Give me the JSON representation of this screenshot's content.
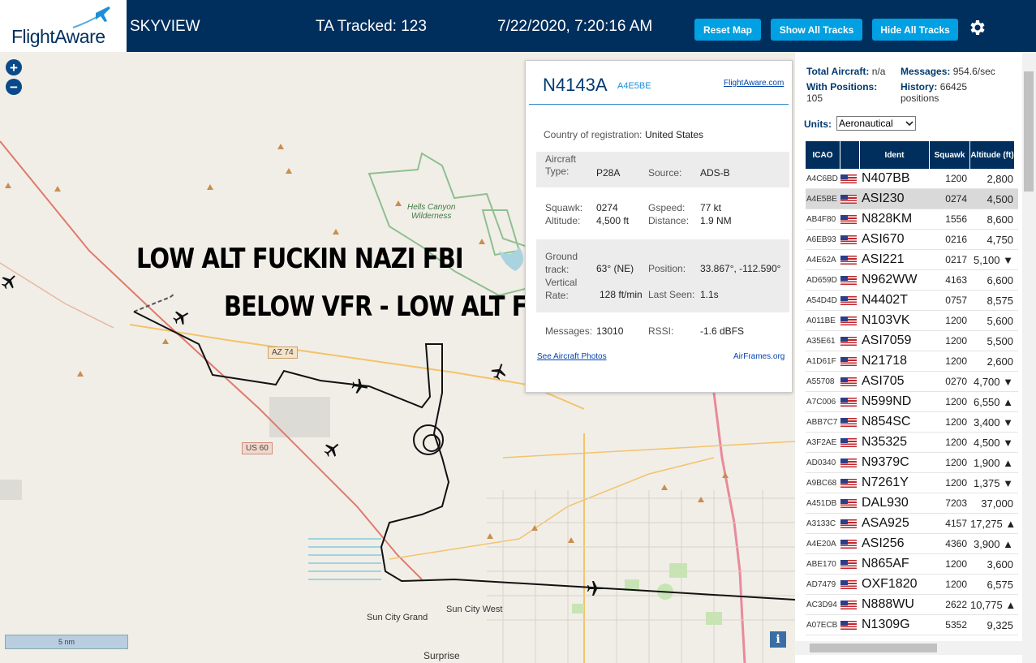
{
  "header": {
    "logo_text": "FlightAware",
    "app_title": "SKYVIEW",
    "tracked": "TA Tracked: 123",
    "datetime": "7/22/2020, 7:20:16 AM",
    "reset_map": "Reset Map",
    "show_all": "Show All Tracks",
    "hide_all": "Hide All Tracks",
    "settings_icon": "gear-icon"
  },
  "map": {
    "zoom_in": "+",
    "zoom_out": "−",
    "overlay_line1": "LOW ALT FUCKIN NAZI FBI",
    "overlay_line2": "BELOW VFR - LOW ALT FUCKIN",
    "scale": "5 nm",
    "info": "i",
    "labels": {
      "wilderness": "Hells Canyon\nWilderness",
      "az74": "AZ 74",
      "us60": "US 60",
      "sun_city_west": "Sun City West",
      "sun_city_grand": "Sun City Grand",
      "surprise": "Surprise"
    }
  },
  "popup": {
    "registration": "N4143A",
    "hex": "A4E5BE",
    "fa_link": "FlightAware.com",
    "country_label": "Country of registration:",
    "country_value": "United States",
    "aircraft_type_label": "Aircraft Type:",
    "aircraft_type_value": "P28A",
    "source_label": "Source:",
    "source_value": "ADS-B",
    "squawk_label": "Squawk:",
    "squawk_value": "0274",
    "gspeed_label": "Gspeed:",
    "gspeed_value": "77 kt",
    "altitude_label": "Altitude:",
    "altitude_value": "4,500 ft",
    "distance_label": "Distance:",
    "distance_value": "1.9 NM",
    "ground_track_label": "Ground track:",
    "ground_track_value": "63° (NE)",
    "position_label": "Position:",
    "position_value": "33.867°, -112.590°",
    "vertical_rate_label": "Vertical Rate:",
    "vertical_rate_value": "128 ft/min",
    "last_seen_label": "Last Seen:",
    "last_seen_value": "1.1s",
    "messages_label": "Messages:",
    "messages_value": "13010",
    "rssi_label": "RSSI:",
    "rssi_value": "-1.6 dBFS",
    "photos_link": "See Aircraft Photos",
    "airframes_link": "AirFrames.org"
  },
  "sidebar": {
    "total_label": "Total Aircraft:",
    "total_value": "n/a",
    "messages_label": "Messages:",
    "messages_value": "954.6/sec",
    "positions_label": "With Positions:",
    "positions_value": "105",
    "history_label": "History:",
    "history_value": "66425 positions",
    "units_label": "Units:",
    "units_value": "Aeronautical",
    "columns": [
      "ICAO",
      "",
      "Ident",
      "Squawk",
      "Altitude (ft)"
    ],
    "rows": [
      {
        "icao": "A4C6BD",
        "ident": "N407BB",
        "squawk": "1200",
        "alt": "2,800"
      },
      {
        "icao": "A4E5BE",
        "ident": "ASI230",
        "squawk": "0274",
        "alt": "4,500"
      },
      {
        "icao": "AB4F80",
        "ident": "N828KM",
        "squawk": "1556",
        "alt": "8,600"
      },
      {
        "icao": "A6EB93",
        "ident": "ASI670",
        "squawk": "0216",
        "alt": "4,750"
      },
      {
        "icao": "A4E62A",
        "ident": "ASI221",
        "squawk": "0217",
        "alt": "5,100 ▼"
      },
      {
        "icao": "AD659D",
        "ident": "N962WW",
        "squawk": "4163",
        "alt": "6,600"
      },
      {
        "icao": "A54D4D",
        "ident": "N4402T",
        "squawk": "0757",
        "alt": "8,575"
      },
      {
        "icao": "A011BE",
        "ident": "N103VK",
        "squawk": "1200",
        "alt": "5,600"
      },
      {
        "icao": "A35E61",
        "ident": "ASI7059",
        "squawk": "1200",
        "alt": "5,500"
      },
      {
        "icao": "A1D61F",
        "ident": "N21718",
        "squawk": "1200",
        "alt": "2,600"
      },
      {
        "icao": "A55708",
        "ident": "ASI705",
        "squawk": "0270",
        "alt": "4,700 ▼"
      },
      {
        "icao": "A7C006",
        "ident": "N599ND",
        "squawk": "1200",
        "alt": "6,550 ▲"
      },
      {
        "icao": "ABB7C7",
        "ident": "N854SC",
        "squawk": "1200",
        "alt": "3,400 ▼"
      },
      {
        "icao": "A3F2AE",
        "ident": "N35325",
        "squawk": "1200",
        "alt": "4,500 ▼"
      },
      {
        "icao": "AD0340",
        "ident": "N9379C",
        "squawk": "1200",
        "alt": "1,900 ▲"
      },
      {
        "icao": "A9BC68",
        "ident": "N7261Y",
        "squawk": "1200",
        "alt": "1,375 ▼"
      },
      {
        "icao": "A451DB",
        "ident": "DAL930",
        "squawk": "7203",
        "alt": "37,000"
      },
      {
        "icao": "A3133C",
        "ident": "ASA925",
        "squawk": "4157",
        "alt": "17,275 ▲"
      },
      {
        "icao": "A4E20A",
        "ident": "ASI256",
        "squawk": "4360",
        "alt": "3,900 ▲"
      },
      {
        "icao": "ABE170",
        "ident": "N865AF",
        "squawk": "1200",
        "alt": "3,600"
      },
      {
        "icao": "AD7479",
        "ident": "OXF1820",
        "squawk": "1200",
        "alt": "6,575"
      },
      {
        "icao": "AC3D94",
        "ident": "N888WU",
        "squawk": "2622",
        "alt": "10,775 ▲"
      },
      {
        "icao": "A07ECB",
        "ident": "N1309G",
        "squawk": "5352",
        "alt": "9,325"
      }
    ],
    "selected_icao": "A4E5BE"
  }
}
